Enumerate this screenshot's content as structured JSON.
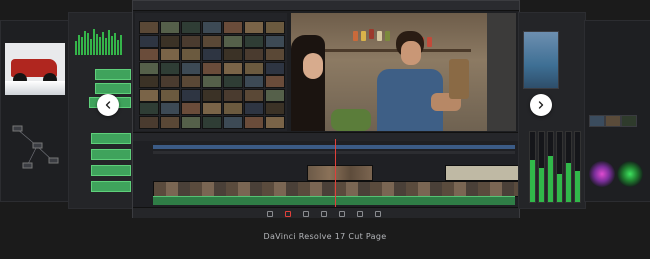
{
  "caption": "DaVinci Resolve 17 Cut Page",
  "nav": {
    "prev_icon": "chevron-left-icon",
    "next_icon": "chevron-right-icon"
  },
  "colors": {
    "background": "#1b1b1b",
    "accent_green": "#35b54a",
    "playhead_red": "#e0403a",
    "nav_button": "#ffffff"
  },
  "slides": {
    "active": "DaVinci Resolve 17 Cut Page",
    "neighbors": [
      "fusion-page",
      "fairlight-page",
      "edit-page",
      "color-page"
    ]
  }
}
